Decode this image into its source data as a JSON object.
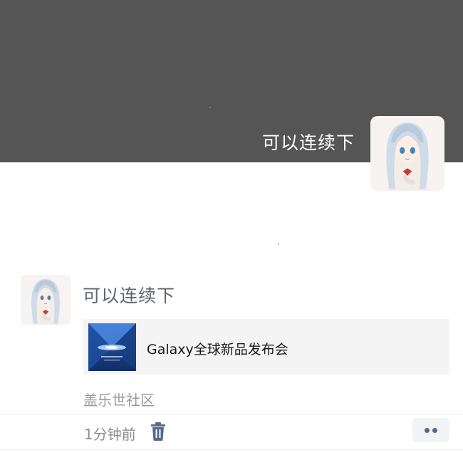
{
  "chat": {
    "message_text": "可以连续下"
  },
  "post": {
    "text": "可以连续下",
    "link": {
      "title": "Galaxy全球新品发布会",
      "thumbnail_icon": "galaxy-event-thumbnail-icon"
    },
    "source": "盖乐世社区",
    "time": "1分钟前",
    "delete_icon": "trash-icon",
    "more_icon": "more-dots-icon"
  },
  "colors": {
    "top_band": "#555555",
    "more_dots": "#526a8c",
    "post_text": "#5d6570",
    "link_card_bg": "#f4f4f4",
    "thumbnail_blue": "#1f6fd6"
  }
}
